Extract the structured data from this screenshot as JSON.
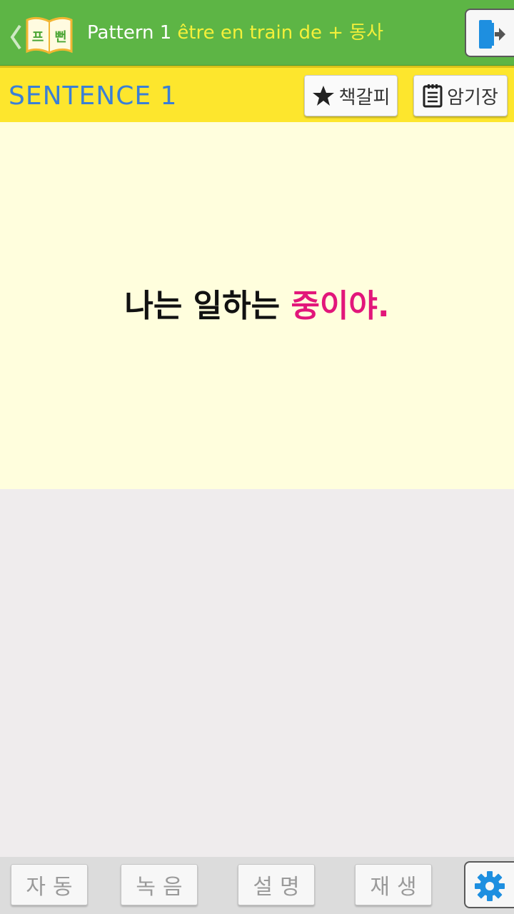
{
  "header": {
    "logo_chars": [
      "프",
      "뻔"
    ],
    "pattern_label": "Pattern 1",
    "pattern_phrase": "être en train de + 동사"
  },
  "sentence_bar": {
    "label": "SENTENCE 1",
    "bookmark_label": "책갈피",
    "memo_label": "암기장"
  },
  "card": {
    "sentence_plain": "나는 일하는 ",
    "sentence_highlight": "중이야."
  },
  "bottom": {
    "auto_label": "자동",
    "record_label": "녹음",
    "explain_label": "설명",
    "play_label": "재생"
  },
  "icons": {
    "back": "chevron-left-icon",
    "logo": "book-logo-icon",
    "exit": "exit-door-icon",
    "bookmark": "star-icon",
    "memo": "notepad-icon",
    "settings": "gear-icon"
  },
  "colors": {
    "header_bg": "#5db545",
    "sentence_bar_bg": "#fde62d",
    "card_bg": "#fffedd",
    "highlight": "#e2167a",
    "sentence_label": "#3a7fd6",
    "title_phrase": "#f4f03a",
    "accent_blue": "#1e8fe0"
  }
}
